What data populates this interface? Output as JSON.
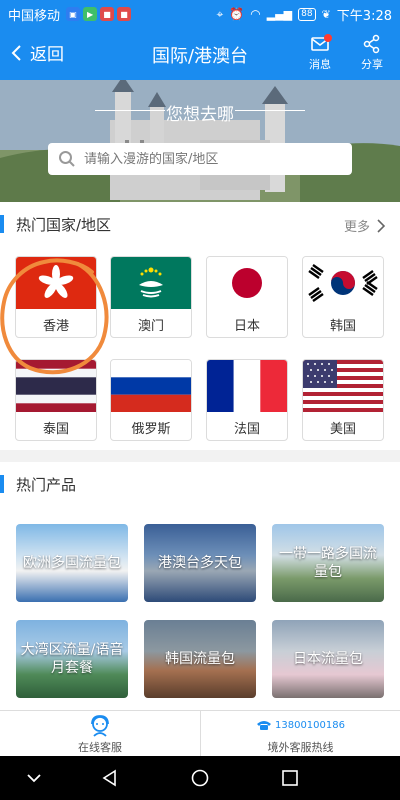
{
  "status_bar": {
    "carrier": "中国移动",
    "battery": "88",
    "time": "下午3:28"
  },
  "header": {
    "back_label": "返回",
    "title": "国际/港澳台",
    "message_label": "消息",
    "share_label": "分享"
  },
  "banner": {
    "title": "您想去哪",
    "search_placeholder": "请输入漫游的国家/地区"
  },
  "hot_regions": {
    "title": "热门国家/地区",
    "more_label": "更多",
    "items": [
      {
        "name": "香港",
        "flag": "hong-kong-flag-icon"
      },
      {
        "name": "澳门",
        "flag": "macau-flag-icon"
      },
      {
        "name": "日本",
        "flag": "japan-flag-icon"
      },
      {
        "name": "韩国",
        "flag": "korea-flag-icon"
      },
      {
        "name": "泰国",
        "flag": "thailand-flag-icon"
      },
      {
        "name": "俄罗斯",
        "flag": "russia-flag-icon"
      },
      {
        "name": "法国",
        "flag": "france-flag-icon"
      },
      {
        "name": "美国",
        "flag": "usa-flag-icon"
      }
    ]
  },
  "hot_products": {
    "title": "热门产品",
    "items": [
      {
        "label": "欧洲多国流量包"
      },
      {
        "label": "港澳台多天包"
      },
      {
        "label": "一带一路多国流量包"
      },
      {
        "label": "大湾区流量/语音月套餐"
      },
      {
        "label": "韩国流量包"
      },
      {
        "label": "日本流量包"
      }
    ]
  },
  "bottom_bar": {
    "service_label": "在线客服",
    "hotline_number": "13800100186",
    "hotline_label": "境外客服热线"
  },
  "colors": {
    "brand": "#1a8cf0",
    "annotation": "#f08a3c"
  }
}
